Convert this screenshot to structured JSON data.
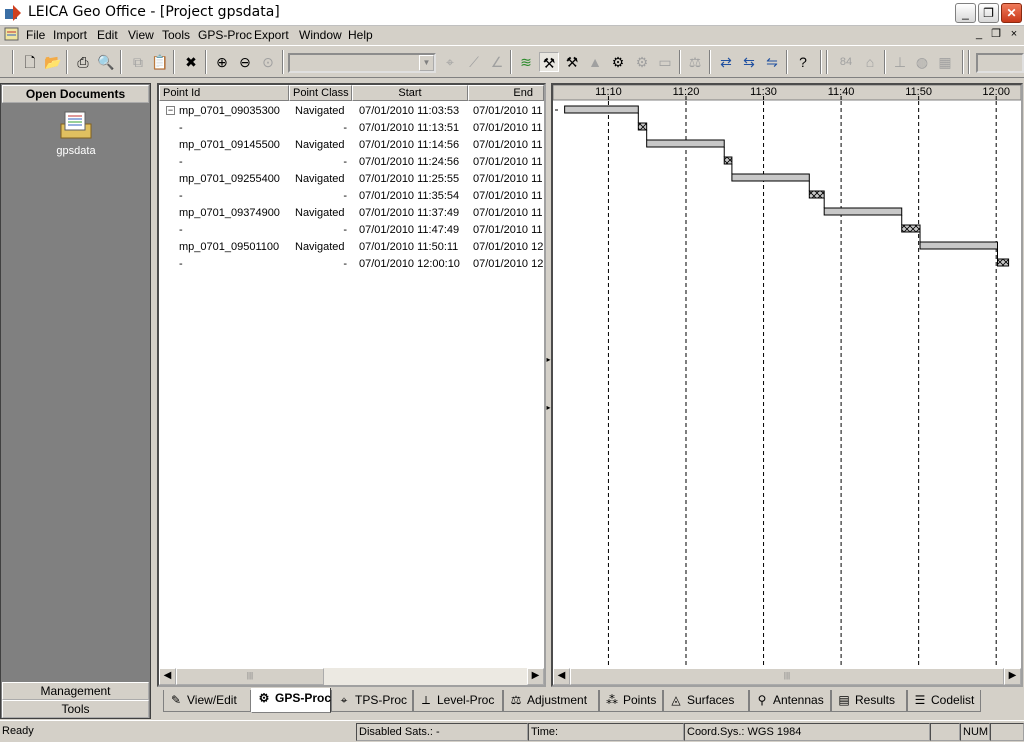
{
  "window": {
    "title": "LEICA Geo Office - [Project gpsdata]",
    "minimize_label": "_",
    "maximize_label": "❐",
    "close_label": "✕"
  },
  "menu": {
    "items": [
      "File",
      "Import",
      "Edit",
      "View",
      "Tools",
      "GPS-Proc",
      "Export",
      "Window",
      "Help"
    ],
    "mdi_min": "_",
    "mdi_restore": "❐",
    "mdi_close": "×"
  },
  "left_panel": {
    "header": "Open Documents",
    "document_label": "gpsdata",
    "management_label": "Management",
    "tools_label": "Tools"
  },
  "table": {
    "columns": [
      "Point Id",
      "Point Class",
      "Start",
      "End"
    ],
    "rows": [
      {
        "point_id": "mp_0701_09035300",
        "point_class": "Navigated",
        "start": "07/01/2010 11:03:53",
        "end": "07/01/2010 11"
      },
      {
        "point_id": "-",
        "point_class": "-",
        "start": "07/01/2010 11:13:51",
        "end": "07/01/2010 11"
      },
      {
        "point_id": "mp_0701_09145500",
        "point_class": "Navigated",
        "start": "07/01/2010 11:14:56",
        "end": "07/01/2010 11"
      },
      {
        "point_id": "-",
        "point_class": "-",
        "start": "07/01/2010 11:24:56",
        "end": "07/01/2010 11"
      },
      {
        "point_id": "mp_0701_09255400",
        "point_class": "Navigated",
        "start": "07/01/2010 11:25:55",
        "end": "07/01/2010 11"
      },
      {
        "point_id": "-",
        "point_class": "-",
        "start": "07/01/2010 11:35:54",
        "end": "07/01/2010 11"
      },
      {
        "point_id": "mp_0701_09374900",
        "point_class": "Navigated",
        "start": "07/01/2010 11:37:49",
        "end": "07/01/2010 11"
      },
      {
        "point_id": "-",
        "point_class": "-",
        "start": "07/01/2010 11:47:49",
        "end": "07/01/2010 11"
      },
      {
        "point_id": "mp_0701_09501100",
        "point_class": "Navigated",
        "start": "07/01/2010 11:50:11",
        "end": "07/01/2010 12"
      },
      {
        "point_id": "-",
        "point_class": "-",
        "start": "07/01/2010 12:00:10",
        "end": "07/01/2010 12"
      }
    ],
    "expander_label": "−"
  },
  "gantt": {
    "time_labels": [
      "11:10",
      "11:20",
      "11:30",
      "11:40",
      "11:50",
      "12:00"
    ],
    "time_minutes": [
      70,
      80,
      90,
      100,
      110,
      120
    ],
    "view_start_minutes": 62.85,
    "view_end_minutes": 123.2,
    "bars": [
      {
        "start": 64.35,
        "end": 73.85,
        "type": "occupation"
      },
      {
        "start": 73.85,
        "end": 74.93,
        "type": "gap"
      },
      {
        "start": 74.93,
        "end": 84.93,
        "type": "occupation"
      },
      {
        "start": 84.93,
        "end": 85.92,
        "type": "gap"
      },
      {
        "start": 85.92,
        "end": 95.9,
        "type": "occupation"
      },
      {
        "start": 95.9,
        "end": 97.82,
        "type": "gap"
      },
      {
        "start": 97.82,
        "end": 107.82,
        "type": "occupation"
      },
      {
        "start": 107.82,
        "end": 110.18,
        "type": "gap"
      },
      {
        "start": 110.18,
        "end": 120.17,
        "type": "occupation"
      },
      {
        "start": 120.17,
        "end": 121.6,
        "type": "gap"
      }
    ],
    "occupation_color": "#c8c8c8",
    "gap_color": "#c8c8c8"
  },
  "bottom_tabs": [
    {
      "label": "View/Edit",
      "icon": "view-edit-icon",
      "glyph": "✎",
      "active": false
    },
    {
      "label": "GPS-Proc",
      "icon": "gps-proc-icon",
      "glyph": "⚙",
      "active": true
    },
    {
      "label": "TPS-Proc",
      "icon": "tps-proc-icon",
      "glyph": "⌖",
      "active": false
    },
    {
      "label": "Level-Proc",
      "icon": "level-proc-icon",
      "glyph": "⟂",
      "active": false
    },
    {
      "label": "Adjustment",
      "icon": "adjustment-icon",
      "glyph": "⚖",
      "active": false
    },
    {
      "label": "Points",
      "icon": "points-icon",
      "glyph": "⁂",
      "active": false
    },
    {
      "label": "Surfaces",
      "icon": "surfaces-icon",
      "glyph": "◬",
      "active": false
    },
    {
      "label": "Antennas",
      "icon": "antennas-icon",
      "glyph": "⚲",
      "active": false
    },
    {
      "label": "Results",
      "icon": "results-icon",
      "glyph": "▤",
      "active": false
    },
    {
      "label": "Codelist",
      "icon": "codelist-icon",
      "glyph": "☰",
      "active": false
    }
  ],
  "status": {
    "ready": "Ready",
    "disabled_sats": "Disabled Sats.: -",
    "time": "Time:",
    "coord_sys": "Coord.Sys.: WGS 1984",
    "num": "NUM"
  }
}
